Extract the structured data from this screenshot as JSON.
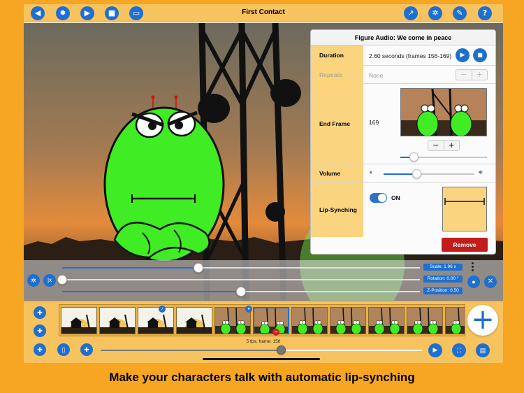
{
  "app": {
    "title": "First Contact"
  },
  "toolbar": {
    "left_buttons": [
      "back-icon",
      "settings-gear-icon",
      "camera-icon",
      "video-icon",
      "screen-icon"
    ],
    "right_buttons": [
      "share-icon",
      "gear-icon",
      "wrench-icon",
      "help-icon"
    ],
    "help_label": "?"
  },
  "panel": {
    "title": "Figure Audio: We come in peace",
    "duration_label": "Duration",
    "duration_value": "2.60 seconds (frames 156-169)",
    "repeats_label": "Repeats",
    "repeats_value": "None",
    "end_frame_label": "End Frame",
    "end_frame_value": "169",
    "volume_label": "Volume",
    "lip_label": "Lip-Synching",
    "lip_toggle_text": "ON",
    "remove_label": "Remove",
    "stepper_minus": "−",
    "stepper_plus": "+",
    "end_frame_slider_fraction": 0.15,
    "volume_fraction": 0.36
  },
  "transform": {
    "scale_label": "Scale: 1.96 x",
    "rotation_label": "Rotation: 0.00 °",
    "zposition_label": "Z-Position: 0.50",
    "scale_fraction": 0.38,
    "rotation_fraction": 0.0,
    "zposition_fraction": 0.5
  },
  "timeline": {
    "fps_text": "5 fps, frame: 156",
    "playhead_fraction": 0.56,
    "add_label": "+",
    "frames": [
      {
        "kind": "house"
      },
      {
        "kind": "house"
      },
      {
        "kind": "house"
      },
      {
        "kind": "house"
      },
      {
        "kind": "aliens"
      },
      {
        "kind": "aliens",
        "selected": true
      },
      {
        "kind": "aliens"
      },
      {
        "kind": "aliens"
      },
      {
        "kind": "aliens"
      },
      {
        "kind": "aliens"
      },
      {
        "kind": "aliens"
      }
    ]
  },
  "caption": "Make your characters talk with automatic lip-synching",
  "colors": {
    "accent": "#1e6fd0",
    "background": "#f6a623",
    "toolbar": "#f7c35e",
    "remove": "#c21d1d",
    "alien": "#37e81e"
  }
}
